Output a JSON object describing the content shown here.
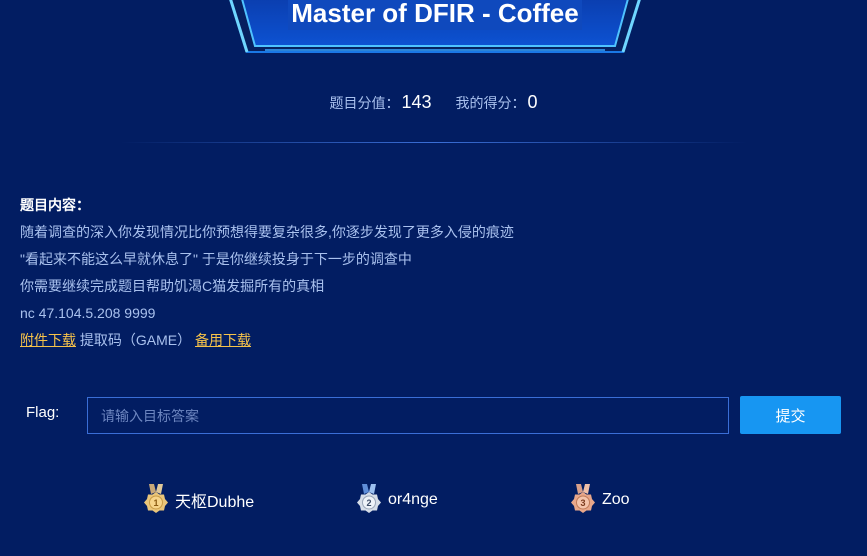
{
  "challenge": {
    "title": "Master of DFIR - Coffee"
  },
  "score": {
    "value_label": "题目分值：",
    "value": "143",
    "my_score_label": "我的得分：",
    "my_score": "0"
  },
  "content": {
    "heading": "题目内容：",
    "lines": [
      "随着调查的深入你发现情况比你预想得要复杂很多,你逐步发现了更多入侵的痕迹",
      "\"看起来不能这么早就休息了\" 于是你继续投身于下一步的调查中",
      "你需要继续完成题目帮助饥渴C猫发掘所有的真相",
      "nc 47.104.5.208 9999"
    ],
    "download_link": "附件下载",
    "extract_code": " 提取码（GAME）",
    "backup_link": "备用下载"
  },
  "flag": {
    "label": "Flag:",
    "placeholder": "请输入目标答案",
    "value": "",
    "submit_label": "提交"
  },
  "rankings": [
    {
      "rank": "1",
      "team": "天枢Dubhe",
      "medal": "gold-medal-icon"
    },
    {
      "rank": "2",
      "team": "or4nge",
      "medal": "silver-medal-icon"
    },
    {
      "rank": "3",
      "team": "Zoo",
      "medal": "bronze-medal-icon"
    }
  ],
  "colors": {
    "background": "#021d62",
    "accent": "#1796f2",
    "link": "#f6c24a",
    "title_bg": "#0f49bd"
  }
}
